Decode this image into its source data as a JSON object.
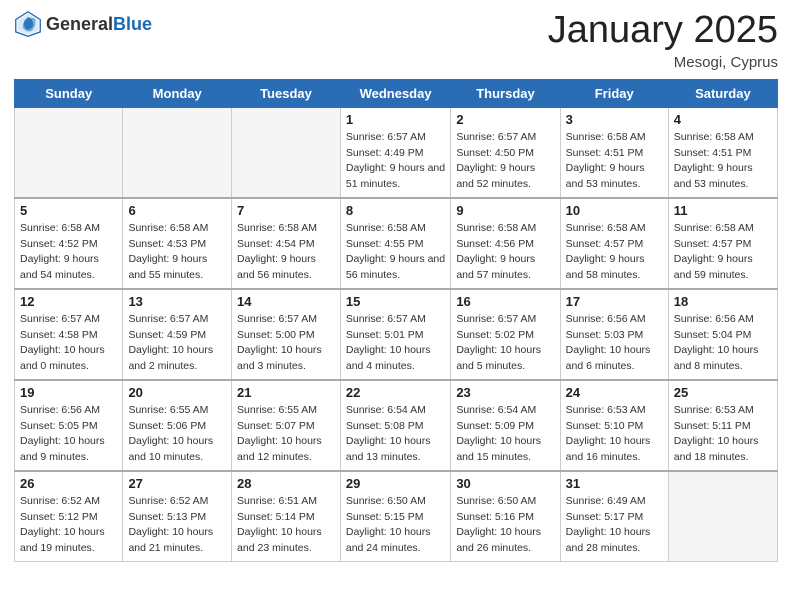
{
  "header": {
    "logo_general": "General",
    "logo_blue": "Blue",
    "title": "January 2025",
    "location": "Mesogi, Cyprus"
  },
  "weekdays": [
    "Sunday",
    "Monday",
    "Tuesday",
    "Wednesday",
    "Thursday",
    "Friday",
    "Saturday"
  ],
  "weeks": [
    [
      {
        "day": "",
        "sunrise": "",
        "sunset": "",
        "daylight": "",
        "empty": true
      },
      {
        "day": "",
        "sunrise": "",
        "sunset": "",
        "daylight": "",
        "empty": true
      },
      {
        "day": "",
        "sunrise": "",
        "sunset": "",
        "daylight": "",
        "empty": true
      },
      {
        "day": "1",
        "sunrise": "Sunrise: 6:57 AM",
        "sunset": "Sunset: 4:49 PM",
        "daylight": "Daylight: 9 hours and 51 minutes."
      },
      {
        "day": "2",
        "sunrise": "Sunrise: 6:57 AM",
        "sunset": "Sunset: 4:50 PM",
        "daylight": "Daylight: 9 hours and 52 minutes."
      },
      {
        "day": "3",
        "sunrise": "Sunrise: 6:58 AM",
        "sunset": "Sunset: 4:51 PM",
        "daylight": "Daylight: 9 hours and 53 minutes."
      },
      {
        "day": "4",
        "sunrise": "Sunrise: 6:58 AM",
        "sunset": "Sunset: 4:51 PM",
        "daylight": "Daylight: 9 hours and 53 minutes."
      }
    ],
    [
      {
        "day": "5",
        "sunrise": "Sunrise: 6:58 AM",
        "sunset": "Sunset: 4:52 PM",
        "daylight": "Daylight: 9 hours and 54 minutes."
      },
      {
        "day": "6",
        "sunrise": "Sunrise: 6:58 AM",
        "sunset": "Sunset: 4:53 PM",
        "daylight": "Daylight: 9 hours and 55 minutes."
      },
      {
        "day": "7",
        "sunrise": "Sunrise: 6:58 AM",
        "sunset": "Sunset: 4:54 PM",
        "daylight": "Daylight: 9 hours and 56 minutes."
      },
      {
        "day": "8",
        "sunrise": "Sunrise: 6:58 AM",
        "sunset": "Sunset: 4:55 PM",
        "daylight": "Daylight: 9 hours and 56 minutes."
      },
      {
        "day": "9",
        "sunrise": "Sunrise: 6:58 AM",
        "sunset": "Sunset: 4:56 PM",
        "daylight": "Daylight: 9 hours and 57 minutes."
      },
      {
        "day": "10",
        "sunrise": "Sunrise: 6:58 AM",
        "sunset": "Sunset: 4:57 PM",
        "daylight": "Daylight: 9 hours and 58 minutes."
      },
      {
        "day": "11",
        "sunrise": "Sunrise: 6:58 AM",
        "sunset": "Sunset: 4:57 PM",
        "daylight": "Daylight: 9 hours and 59 minutes."
      }
    ],
    [
      {
        "day": "12",
        "sunrise": "Sunrise: 6:57 AM",
        "sunset": "Sunset: 4:58 PM",
        "daylight": "Daylight: 10 hours and 0 minutes."
      },
      {
        "day": "13",
        "sunrise": "Sunrise: 6:57 AM",
        "sunset": "Sunset: 4:59 PM",
        "daylight": "Daylight: 10 hours and 2 minutes."
      },
      {
        "day": "14",
        "sunrise": "Sunrise: 6:57 AM",
        "sunset": "Sunset: 5:00 PM",
        "daylight": "Daylight: 10 hours and 3 minutes."
      },
      {
        "day": "15",
        "sunrise": "Sunrise: 6:57 AM",
        "sunset": "Sunset: 5:01 PM",
        "daylight": "Daylight: 10 hours and 4 minutes."
      },
      {
        "day": "16",
        "sunrise": "Sunrise: 6:57 AM",
        "sunset": "Sunset: 5:02 PM",
        "daylight": "Daylight: 10 hours and 5 minutes."
      },
      {
        "day": "17",
        "sunrise": "Sunrise: 6:56 AM",
        "sunset": "Sunset: 5:03 PM",
        "daylight": "Daylight: 10 hours and 6 minutes."
      },
      {
        "day": "18",
        "sunrise": "Sunrise: 6:56 AM",
        "sunset": "Sunset: 5:04 PM",
        "daylight": "Daylight: 10 hours and 8 minutes."
      }
    ],
    [
      {
        "day": "19",
        "sunrise": "Sunrise: 6:56 AM",
        "sunset": "Sunset: 5:05 PM",
        "daylight": "Daylight: 10 hours and 9 minutes."
      },
      {
        "day": "20",
        "sunrise": "Sunrise: 6:55 AM",
        "sunset": "Sunset: 5:06 PM",
        "daylight": "Daylight: 10 hours and 10 minutes."
      },
      {
        "day": "21",
        "sunrise": "Sunrise: 6:55 AM",
        "sunset": "Sunset: 5:07 PM",
        "daylight": "Daylight: 10 hours and 12 minutes."
      },
      {
        "day": "22",
        "sunrise": "Sunrise: 6:54 AM",
        "sunset": "Sunset: 5:08 PM",
        "daylight": "Daylight: 10 hours and 13 minutes."
      },
      {
        "day": "23",
        "sunrise": "Sunrise: 6:54 AM",
        "sunset": "Sunset: 5:09 PM",
        "daylight": "Daylight: 10 hours and 15 minutes."
      },
      {
        "day": "24",
        "sunrise": "Sunrise: 6:53 AM",
        "sunset": "Sunset: 5:10 PM",
        "daylight": "Daylight: 10 hours and 16 minutes."
      },
      {
        "day": "25",
        "sunrise": "Sunrise: 6:53 AM",
        "sunset": "Sunset: 5:11 PM",
        "daylight": "Daylight: 10 hours and 18 minutes."
      }
    ],
    [
      {
        "day": "26",
        "sunrise": "Sunrise: 6:52 AM",
        "sunset": "Sunset: 5:12 PM",
        "daylight": "Daylight: 10 hours and 19 minutes."
      },
      {
        "day": "27",
        "sunrise": "Sunrise: 6:52 AM",
        "sunset": "Sunset: 5:13 PM",
        "daylight": "Daylight: 10 hours and 21 minutes."
      },
      {
        "day": "28",
        "sunrise": "Sunrise: 6:51 AM",
        "sunset": "Sunset: 5:14 PM",
        "daylight": "Daylight: 10 hours and 23 minutes."
      },
      {
        "day": "29",
        "sunrise": "Sunrise: 6:50 AM",
        "sunset": "Sunset: 5:15 PM",
        "daylight": "Daylight: 10 hours and 24 minutes."
      },
      {
        "day": "30",
        "sunrise": "Sunrise: 6:50 AM",
        "sunset": "Sunset: 5:16 PM",
        "daylight": "Daylight: 10 hours and 26 minutes."
      },
      {
        "day": "31",
        "sunrise": "Sunrise: 6:49 AM",
        "sunset": "Sunset: 5:17 PM",
        "daylight": "Daylight: 10 hours and 28 minutes."
      },
      {
        "day": "",
        "sunrise": "",
        "sunset": "",
        "daylight": "",
        "empty": true
      }
    ]
  ]
}
